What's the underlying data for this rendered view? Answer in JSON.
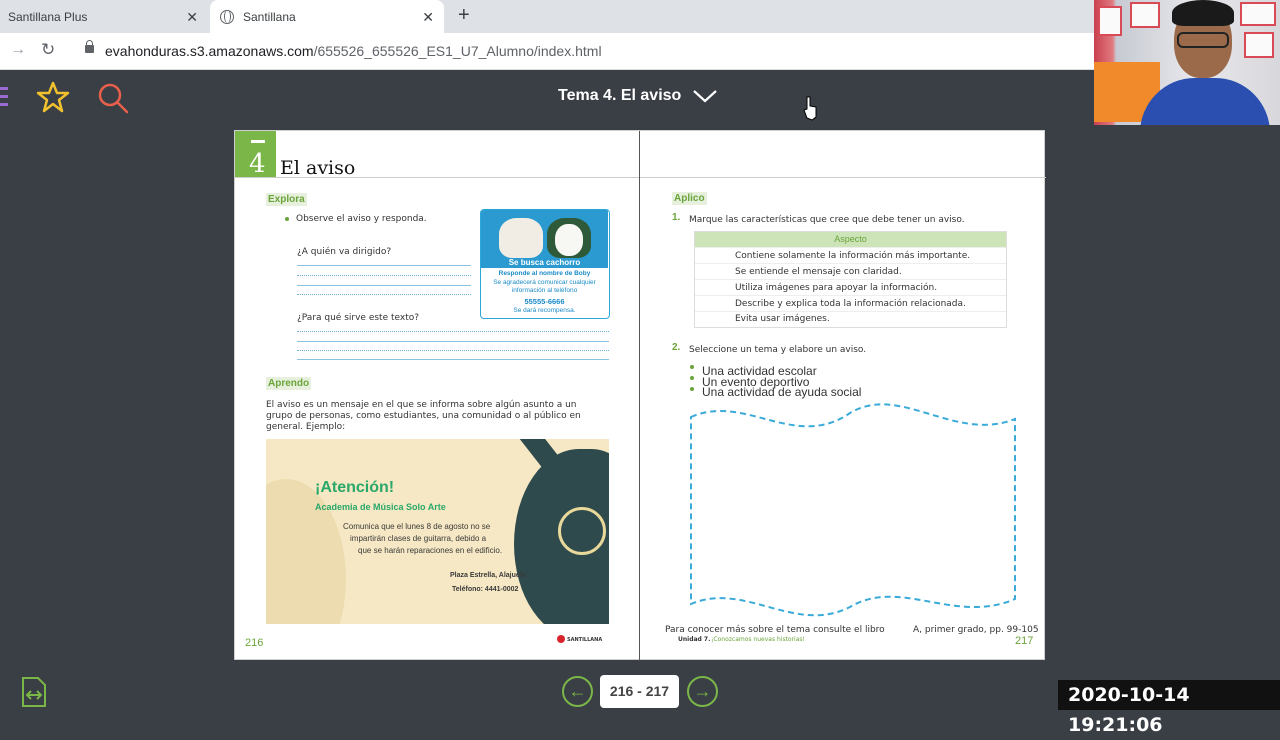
{
  "browser": {
    "tab1_title": "Santillana Plus",
    "tab2_title": "Santillana",
    "close": "✕",
    "new_tab": "+",
    "url_host": "evahonduras.s3.amazonaws.com",
    "url_path": "/655526_655526_ES1_U7_Alumno/index.html"
  },
  "appbar": {
    "topic": "Tema 4. El aviso"
  },
  "book": {
    "badge_number": "4",
    "title": "El aviso",
    "left": {
      "explora": "Explora",
      "q_intro": "Observe el aviso y responda.",
      "q1": "¿A quién va dirigido?",
      "q2": "¿Para qué sirve este texto?",
      "ad": {
        "header": "Se busca cachorro",
        "l1": "Responde al nombre de Boby",
        "l2": "Se agradecerá comunicar cualquier",
        "l3": "información al teléfono",
        "phone": "55555-6666",
        "l4": "Se dará recompensa."
      },
      "aprendo": "Aprendo",
      "def1": "El aviso es un mensaje en el que se informa sobre algún asunto a un",
      "def2": "grupo de personas, como estudiantes, una comunidad o al público en",
      "def3": "general. Ejemplo:",
      "poster": {
        "title": "¡Atención!",
        "subtitle": "Academia de Música Solo Arte",
        "b1": "Comunica que el lunes 8 de agosto no se",
        "b2": "impartirán clases de guitarra, debido a",
        "b3": "que se harán reparaciones en el edificio.",
        "place": "Plaza Estrella, Alajuela",
        "phone": "Teléfono: 4441-0002"
      },
      "page_number": "216",
      "publisher": "SANTILLANA"
    },
    "right": {
      "aplico": "Aplico",
      "n1": "1.",
      "q1": "Marque las características que cree que debe tener un aviso.",
      "table_header": "Aspecto",
      "rows": [
        "Contiene solamente la información más importante.",
        "Se entiende el mensaje con claridad.",
        "Utiliza imágenes para apoyar la información.",
        "Describe y explica toda la información relacionada.",
        "Evita usar imágenes."
      ],
      "n2": "2.",
      "q2": "Seleccione un tema y elabore un aviso.",
      "options": [
        "Una actividad escolar",
        "Un evento deportivo",
        "Una actividad de ayuda social"
      ],
      "footnote": "Para conocer más sobre el tema consulte el libro",
      "footnote_end": "A, primer grado, pp. 99-105",
      "unit_label": "Unidad 7.",
      "unit_title": "¡Conozcamos nuevas historias!",
      "page_number": "217"
    }
  },
  "footer": {
    "pages": "216 - 217",
    "prev": "←",
    "next": "→"
  },
  "timestamp": "2020-10-14  19:21:06",
  "colors": {
    "accent_green": "#7ab648",
    "appbar": "#3a3e45",
    "ad_blue": "#2a9ad0"
  },
  "icons": [
    "menu-icon",
    "star-icon",
    "search-icon",
    "chevron-down-icon",
    "cursor-icon",
    "document-icon"
  ]
}
